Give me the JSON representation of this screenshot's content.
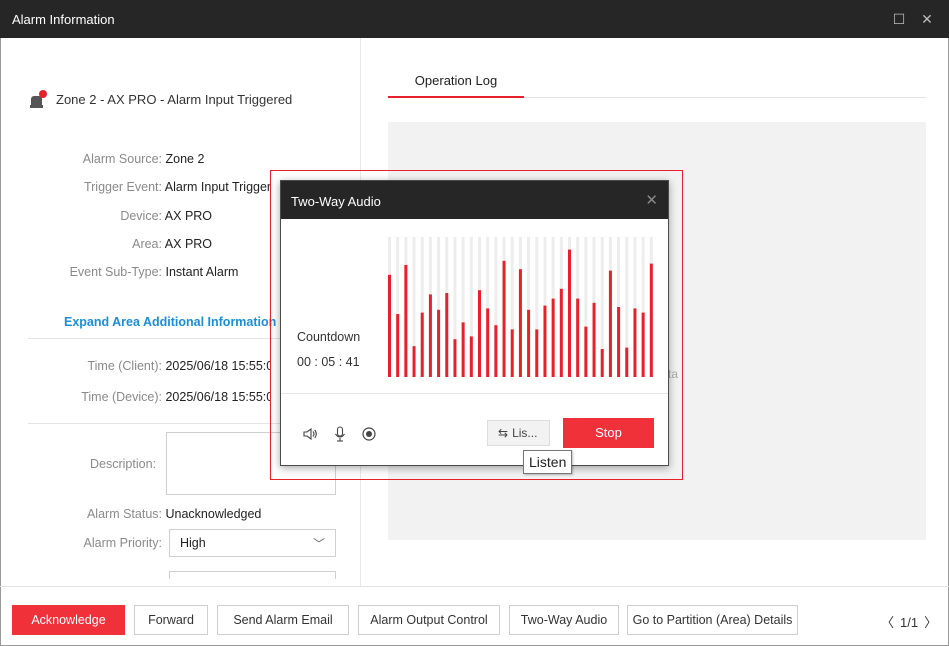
{
  "window": {
    "title": "Alarm Information",
    "maximize_icon": "square-icon",
    "close_icon": "x-icon"
  },
  "alarm": {
    "heading": "Zone 2 - AX PRO - Alarm Input Triggered",
    "fields": [
      {
        "label": "Alarm Source:",
        "value": "Zone 2"
      },
      {
        "label": "Trigger Event:",
        "value": "Alarm Input Triggered"
      },
      {
        "label": "Device:",
        "value": "AX PRO"
      },
      {
        "label": "Area:",
        "value": "AX PRO"
      },
      {
        "label": "Event Sub-Type:",
        "value": "Instant Alarm"
      }
    ],
    "expand_link": "Expand Area Additional Information",
    "time_client": {
      "label": "Time (Client):",
      "value": "2025/06/18 15:55:02"
    },
    "time_device": {
      "label": "Time (Device):",
      "value": "2025/06/18 15:55:02"
    },
    "description_label": "Description:",
    "status": {
      "label": "Alarm Status:",
      "value": "Unacknowledged"
    },
    "priority": {
      "label": "Alarm Priority:",
      "value": "High"
    }
  },
  "right_panel": {
    "tab": "Operation Log",
    "ghost_text": "ta"
  },
  "dialog": {
    "title": "Two-Way Audio",
    "countdown_label": "Countdown",
    "countdown_value": "00 : 05 : 41",
    "listen_label": "Lis...",
    "stop_label": "Stop",
    "tooltip": "Listen",
    "wave_levels": [
      0.73,
      0.45,
      0.8,
      0.22,
      0.46,
      0.59,
      0.48,
      0.6,
      0.27,
      0.39,
      0.29,
      0.62,
      0.49,
      0.37,
      0.83,
      0.34,
      0.77,
      0.48,
      0.34,
      0.51,
      0.56,
      0.63,
      0.91,
      0.56,
      0.36,
      0.53,
      0.2,
      0.76,
      0.5,
      0.21,
      0.49,
      0.46,
      0.81
    ],
    "accent": "#e8202a"
  },
  "footer": {
    "buttons": [
      "Acknowledge",
      "Forward",
      "Send Alarm Email",
      "Alarm Output Control",
      "Two-Way Audio",
      "Go to Partition (Area) Details"
    ],
    "pager": "1/1"
  },
  "colors": {
    "titlebar": "#262626",
    "accent": "#f0313a",
    "link": "#1a8fd9"
  }
}
